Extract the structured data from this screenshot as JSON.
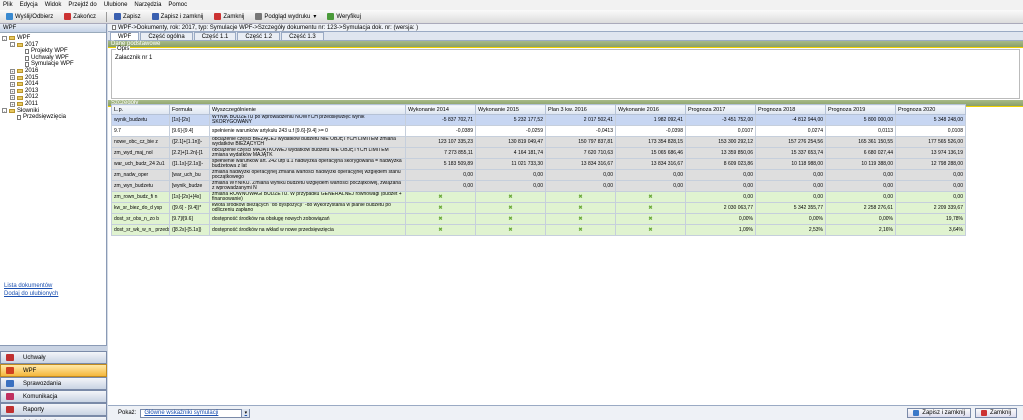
{
  "menu": [
    "Plik",
    "Edycja",
    "Widok",
    "Przejdź do",
    "Ulubione",
    "Narzędzia",
    "Pomoc"
  ],
  "toolbar": {
    "send": "Wyślij/Odbierz",
    "close_top": "Zakończ",
    "save": "Zapisz",
    "save_close": "Zapisz i zamknij",
    "close": "Zamknij",
    "preview": "Podgląd wydruku",
    "verify": "Weryfikuj"
  },
  "left": {
    "title": "WPF",
    "tree": [
      {
        "label": "WPF",
        "level": 0,
        "type": "folder",
        "exp": "-"
      },
      {
        "label": "2017",
        "level": 1,
        "type": "folder",
        "exp": "-"
      },
      {
        "label": "Projekty WPF",
        "level": 2,
        "type": "doc"
      },
      {
        "label": "Uchwały WPF",
        "level": 2,
        "type": "doc"
      },
      {
        "label": "Symulacje WPF",
        "level": 2,
        "type": "doc"
      },
      {
        "label": "2016",
        "level": 1,
        "type": "folder",
        "exp": "+"
      },
      {
        "label": "2015",
        "level": 1,
        "type": "folder",
        "exp": "+"
      },
      {
        "label": "2014",
        "level": 1,
        "type": "folder",
        "exp": "+"
      },
      {
        "label": "2013",
        "level": 1,
        "type": "folder",
        "exp": "+"
      },
      {
        "label": "2012",
        "level": 1,
        "type": "folder",
        "exp": "+"
      },
      {
        "label": "2011",
        "level": 1,
        "type": "folder",
        "exp": "+"
      },
      {
        "label": "Słowniki",
        "level": 0,
        "type": "folder",
        "exp": "-"
      },
      {
        "label": "Przedsięwzięcia",
        "level": 1,
        "type": "doc"
      }
    ],
    "links": [
      "Lista dokumentów",
      "Dodaj do ulubionych"
    ],
    "nav": [
      {
        "label": "Uchwały",
        "active": false,
        "color": "#c03030"
      },
      {
        "label": "WPF",
        "active": true,
        "color": "#d04020"
      },
      {
        "label": "Sprawozdania",
        "active": false,
        "color": "#3a70c0"
      },
      {
        "label": "Komunikacja",
        "active": false,
        "color": "#c03060"
      },
      {
        "label": "Raporty",
        "active": false,
        "color": "#c03030"
      },
      {
        "label": "Administracja",
        "active": false,
        "color": "#5a5a9a"
      }
    ]
  },
  "main": {
    "path": "WPF->Dokumenty, rok: 2017, typ: Symulacje WPF->Szczegóły dokumentu nr: 123->Symulacja dok. nr:  (wersja: )",
    "tabs": [
      "WPF",
      "Część ogólna",
      "Część 1.1",
      "Część 1.2",
      "Część 1.3"
    ],
    "sec1": "Dane podstawowe",
    "opis_label": "Opis",
    "opis_value": "Załacznik nr 1",
    "sec2": "Szczegóły",
    "columns": [
      "L.p.",
      "Formuła",
      "Wyszczególnienie",
      "Wykonanie 2014",
      "Wykonanie 2015",
      "Plan 3 kw. 2016",
      "Wykonanie 2016",
      "Prognoza 2017",
      "Prognoza 2018",
      "Prognoza 2019",
      "Prognoza 2020"
    ],
    "rows": [
      {
        "style": "sel",
        "c": [
          "wynik_budzetu",
          "[1s]-[2s]",
          "WYNIK BUDŻETU po wprowadzeniu NOWYCH przedsięwzięć wynik  SKORYGOWANY",
          "-5 837 702,71",
          "5 232 177,52",
          "2 017 502,41",
          "1 982 092,41",
          "-3 451 752,00",
          "-4 812 944,00",
          "5 800 000,00",
          "5 348 248,00"
        ]
      },
      {
        "style": "white",
        "c": [
          "9.7",
          "[9.6]-[9.4]",
          "  spełnienie warunków artykułu 243 u.f [9.6]-[9.4] >= 0",
          "-0,0389",
          "-0,0259",
          "-0,0413",
          "-0,0398",
          "0,0107",
          "0,0274",
          "0,0113",
          "0,0108"
        ]
      },
      {
        "style": "gray",
        "c": [
          "nowe_obc_cz_bie z",
          "([2.1]+[1.1n])-",
          "obciążenie części BIEŻĄCEJ wydatków budżetu NIE OBJĘTYCH LIMITEM zmiana  wydatków BIEŻĄCYCH",
          "123 107 335,23",
          "130 819 049,47",
          "150 797 837,81",
          "173 354 828,15",
          "153 300 292,12",
          "157 276 254,56",
          "165 361 150,55",
          "177 565 526,00"
        ]
      },
      {
        "style": "gray",
        "c": [
          "zm_wyd_maj_nol",
          "[2.2]+[1.2n]-[1",
          "obciążenie części MAJĄTKOWEJ wydatków budżetu NIE OBJĘTYCH LIMITEM zmiana wydatków MAJĄTK",
          "7 273 855,11",
          "4 164 181,74",
          "7 620 710,63",
          "15 065 686,46",
          "13 359 850,06",
          "15 337 653,74",
          "6 680 027,44",
          "13 974 136,19"
        ]
      },
      {
        "style": "gray",
        "c": [
          "war_uch_budz_24 2u1",
          "([1.1s]-[2.1s])-",
          "spełnienie warunków art. 242 ufp u.1 nadwyżka operacyjna skorygowana = nadwyżka budżetowa z lat",
          "5 183 509,89",
          "11 021 733,30",
          "13 834 316,67",
          "13 834 316,67",
          "8 609 023,86",
          "10 118 988,00",
          "10 119 388,00",
          "12 798 288,00"
        ]
      },
      {
        "style": "gray",
        "c": [
          "zm_nadw_oper",
          "[war_uch_bu",
          "zmiana nadwyżki operacyjnej zmiana wartości nadwyżki operacyjnej  względem stanu początkowego",
          "0,00",
          "0,00",
          "0,00",
          "0,00",
          "0,00",
          "0,00",
          "0,00",
          "0,00"
        ]
      },
      {
        "style": "gray",
        "c": [
          "zm_wyn_budzetu",
          "[wynik_budze",
          "zmiana WYNIKU. Zmiana wyniku budżetu względem wartości początkowej, związana z wprowadzanymi N",
          "0,00",
          "0,00",
          "0,00",
          "0,00",
          "0,00",
          "0,00",
          "0,00",
          "0,00"
        ]
      },
      {
        "style": "green",
        "x": true,
        "c": [
          "zm_rown_budz_fi n",
          "[1s]-[2s]+[4s]",
          "zmiana RÓWNOWAGI BUDŻETU. W przypadku GENERALNEJ równowagi   (budżet + finansowanie)",
          "",
          "",
          "",
          "",
          "0,00",
          "0,00",
          "0,00",
          "0,00"
        ]
      },
      {
        "style": "green",
        "x": true,
        "c": [
          "kw_sr_biez_do_d ysp",
          "([9.6] - [9.4])*",
          "kwota środków bieżących \"do dyspozycji\" -do wykorzystania w planie budżetu po odliczeniu zapłano",
          "",
          "",
          "",
          "",
          "2 030 063,77",
          "5 342 355,77",
          "2 258 276,61",
          "2 209 339,67"
        ]
      },
      {
        "style": "green",
        "x": true,
        "c": [
          "dost_sr_obs_n_zo b",
          "[9.7]/[9.6]",
          "dostępność środków na obsługę nowych zobowiązań",
          "",
          "",
          "",
          "",
          "0,00%",
          "0,00%",
          "0,00%",
          "19,78%"
        ]
      },
      {
        "style": "green",
        "x": true,
        "c": [
          "dost_sr_wk_w_n_ przeds",
          "([8.2s]-[5.1s])",
          "dostępność środków na wkład w nowe przedsięwzięcia",
          "",
          "",
          "",
          "",
          "1,09%",
          "2,53%",
          "2,16%",
          "3,64%"
        ]
      }
    ]
  },
  "bottom": {
    "show_label": "Pokaż:",
    "show_value": "Główne wskaźniki symulacji",
    "save_close": "Zapisz i zamknij",
    "close": "Zamknij"
  }
}
